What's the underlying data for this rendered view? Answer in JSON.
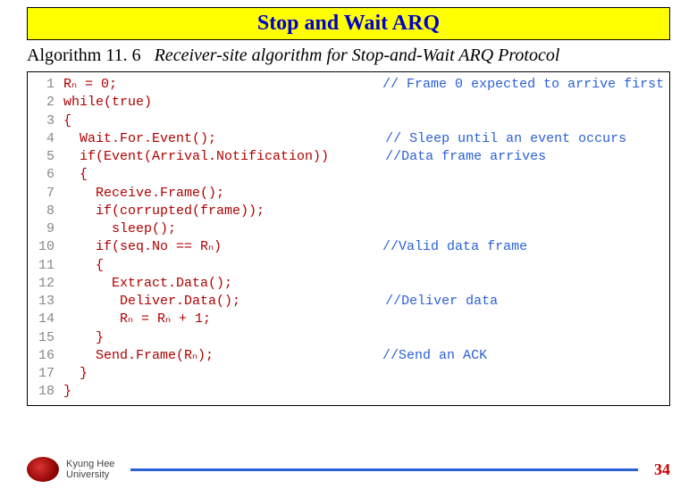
{
  "title": "Stop and Wait ARQ",
  "caption": {
    "label": "Algorithm 11. 6",
    "desc": "Receiver-site algorithm for Stop-and-Wait ARQ Protocol"
  },
  "code": [
    {
      "n": "1",
      "code": "R_n = 0;",
      "indent": 0,
      "comment": "// Frame 0 expected to arrive first"
    },
    {
      "n": "2",
      "code": "while(true)",
      "indent": 0,
      "comment": ""
    },
    {
      "n": "3",
      "code": "{",
      "indent": 0,
      "comment": ""
    },
    {
      "n": "4",
      "code": "Wait.For.Event();",
      "indent": 1,
      "comment": "// Sleep until an event occurs"
    },
    {
      "n": "5",
      "code": "if(Event(Arrival.Notification))",
      "indent": 1,
      "comment": "//Data frame arrives"
    },
    {
      "n": "6",
      "code": "{",
      "indent": 1,
      "comment": ""
    },
    {
      "n": "7",
      "code": "Receive.Frame();",
      "indent": 2,
      "comment": ""
    },
    {
      "n": "8",
      "code": "if(corrupted(frame));",
      "indent": 2,
      "comment": ""
    },
    {
      "n": "9",
      "code": "  sleep();",
      "indent": 2,
      "comment": ""
    },
    {
      "n": "10",
      "code": "if(seq.No == R_n)",
      "indent": 2,
      "comment": "//Valid data frame"
    },
    {
      "n": "11",
      "code": "{",
      "indent": 2,
      "comment": ""
    },
    {
      "n": "12",
      "code": "Extract.Data();",
      "indent": 3,
      "comment": ""
    },
    {
      "n": "13",
      "code": " Deliver.Data();",
      "indent": 3,
      "comment": "//Deliver data"
    },
    {
      "n": "14",
      "code": " R_n = R_n + 1;",
      "indent": 3,
      "comment": ""
    },
    {
      "n": "15",
      "code": "}",
      "indent": 2,
      "comment": ""
    },
    {
      "n": "16",
      "code": "Send.Frame(R_n);",
      "indent": 2,
      "comment": "//Send an ACK"
    },
    {
      "n": "17",
      "code": "}",
      "indent": 1,
      "comment": ""
    },
    {
      "n": "18",
      "code": "}",
      "indent": 0,
      "comment": ""
    }
  ],
  "footer": {
    "uni_line1": "Kyung Hee",
    "uni_line2": "University",
    "page": "34"
  },
  "layout": {
    "indent_unit": "  ",
    "comment_col": 40
  }
}
